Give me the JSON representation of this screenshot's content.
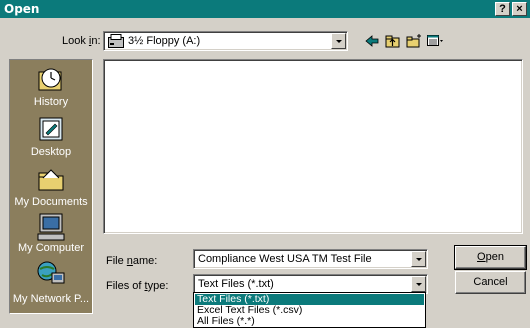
{
  "window": {
    "title": "Open",
    "help_button": "?",
    "close_button": "×"
  },
  "lookin": {
    "label_prefix": "Look ",
    "label_accel": "i",
    "label_suffix": "n:",
    "value": "3½ Floppy (A:)",
    "icon": "floppy-drive-icon"
  },
  "toolbar": {
    "icons": [
      "back-arrow-icon",
      "up-one-level-icon",
      "new-folder-icon",
      "views-menu-icon"
    ]
  },
  "places": [
    {
      "label": "History",
      "icon": "history-icon"
    },
    {
      "label": "Desktop",
      "icon": "desktop-icon"
    },
    {
      "label": "My Documents",
      "icon": "my-documents-icon"
    },
    {
      "label": "My Computer",
      "icon": "my-computer-icon"
    },
    {
      "label": "My Network P...",
      "icon": "my-network-places-icon"
    }
  ],
  "filename": {
    "label_prefix": "File ",
    "label_accel": "n",
    "label_suffix": "ame:",
    "value": "Compliance West USA TM Test File"
  },
  "filetype": {
    "label_prefix": "Files of ",
    "label_accel": "t",
    "label_suffix": "ype:",
    "value": "Text Files (*.txt)",
    "options": [
      "Text Files (*.txt)",
      "Excel Text Files (*.csv)",
      "All Files (*.*)"
    ],
    "selected_index": 0
  },
  "buttons": {
    "open_accel": "O",
    "open_rest": "pen",
    "cancel": "Cancel"
  },
  "colors": {
    "title_bar": "#0b7a7b",
    "selection": "#0b7a7b",
    "places_bar": "#8b7e5d",
    "face": "#d4d0c8"
  }
}
